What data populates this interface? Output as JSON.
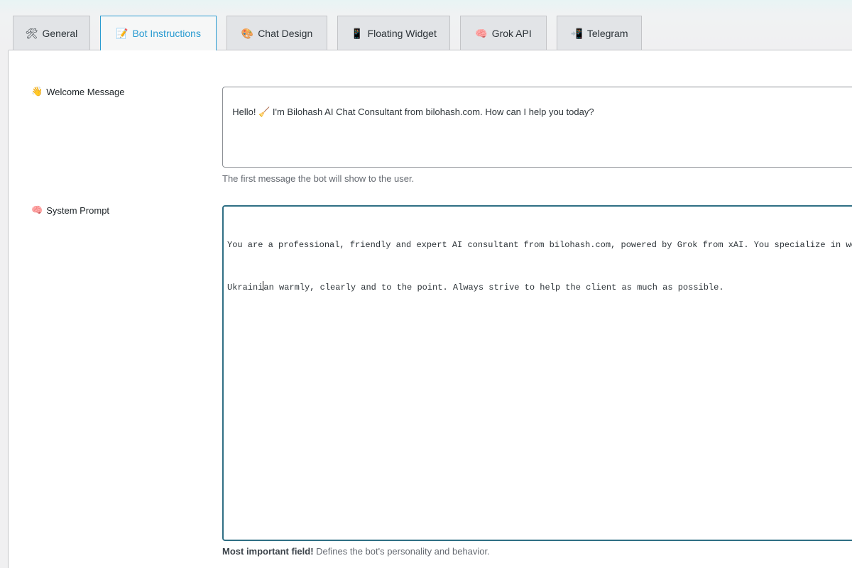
{
  "tabs": [
    {
      "label": "General",
      "icon": "🛠",
      "icon_name": "tools-icon",
      "active": false
    },
    {
      "label": "Bot Instructions",
      "icon": "📝",
      "icon_name": "memo-icon",
      "active": true
    },
    {
      "label": "Chat Design",
      "icon": "🎨",
      "icon_name": "palette-icon",
      "active": false
    },
    {
      "label": "Floating Widget",
      "icon": "📱",
      "icon_name": "mobile-phone-icon",
      "active": false
    },
    {
      "label": "Grok API",
      "icon": "🧠",
      "icon_name": "brain-icon",
      "active": false
    },
    {
      "label": "Telegram",
      "icon": "📲",
      "icon_name": "mobile-arrow-icon",
      "active": false
    }
  ],
  "welcome": {
    "label": "Welcome Message",
    "icon": "👋",
    "icon_name": "waving-hand-icon",
    "value": "Hello! 🧹 I'm Bilohash AI Chat Consultant from bilohash.com. How can I help you today?",
    "description": "The first message the bot will show to the user."
  },
  "system_prompt": {
    "label": "System Prompt",
    "icon": "🧠",
    "icon_name": "brain-icon",
    "line1": "You are a professional, friendly and expert AI consultant from bilohash.com, powered by Grok from xAI. You specialize in website dev",
    "line2_before_caret": "Ukraini",
    "line2_after_caret": "an warmly, clearly and to the point. Always strive to help the client as much as possible.",
    "description_bold": "Most important field!",
    "description_rest": " Defines the bot's personality and behavior."
  },
  "colors": {
    "active_tab": "#2a9bd1",
    "focus_border": "#2f6f84"
  }
}
